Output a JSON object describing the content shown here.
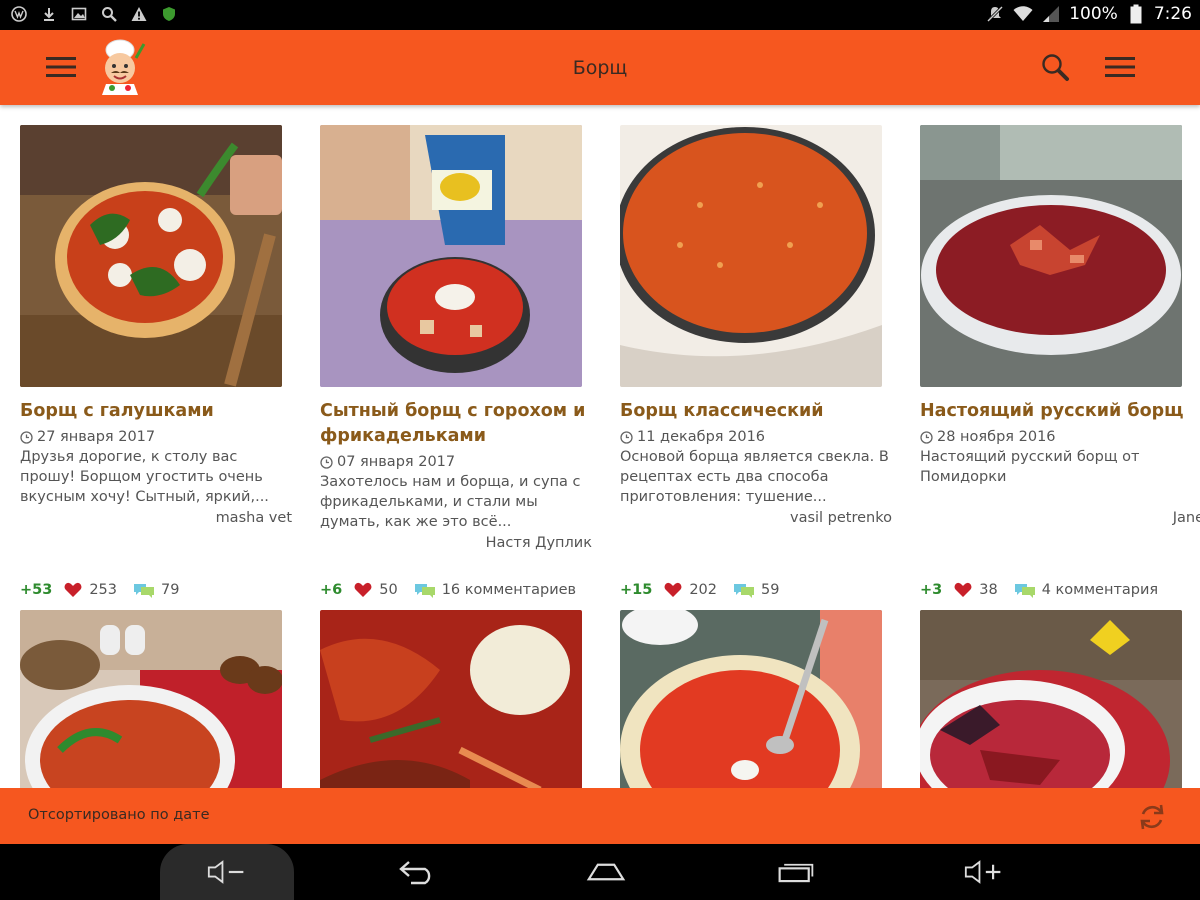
{
  "status_bar": {
    "battery": "100%",
    "time": "7:26",
    "left_icons": [
      "vpn-icon",
      "download-icon",
      "image-icon",
      "search-icon",
      "warning-icon",
      "shield-icon"
    ],
    "right_icons": [
      "silent-icon",
      "wifi-icon",
      "signal-icon",
      "battery-icon"
    ]
  },
  "app_bar": {
    "title": "Борщ",
    "icons": [
      "menu-icon",
      "chef-logo",
      "search-icon",
      "overflow-menu-icon"
    ]
  },
  "accent_color": "#f6571f",
  "recipes": [
    {
      "title": "Борщ с галушками",
      "date": "27 января 2017",
      "description": "Друзья дорогие, к столу вас прошу! Борщом угостить очень вкусным хочу! Сытный, яркий,...",
      "author": "masha vet",
      "rating": "+53",
      "likes": "253",
      "comments": "79"
    },
    {
      "title": "Сытный борщ с горохом и фрикадельками",
      "date": "07 января 2017",
      "description": "Захотелось нам и борща, и супа с фрикадельками, и стали мы думать, как же это всё...",
      "author": "Настя Дуплик",
      "rating": "+6",
      "likes": "50",
      "comments": "16 комментариев"
    },
    {
      "title": "Борщ классический",
      "date": "11 декабря 2016",
      "description": "Основой борща является свекла. В рецептах есть два способа приготовления: тушение...",
      "author": "vasil petrenko",
      "rating": "+15",
      "likes": "202",
      "comments": "59"
    },
    {
      "title": "Настоящий русский борщ",
      "date": "28 ноября 2016",
      "description": "Настоящий русский борщ от Помидорки",
      "author": "Jane",
      "rating": "+3",
      "likes": "38",
      "comments": "4 комментария"
    }
  ],
  "second_row_thumbnails": [
    "borscht-photo-5",
    "borscht-photo-6",
    "borscht-photo-7",
    "borscht-photo-8"
  ],
  "sort_bar": {
    "label": "Отсортировано по дате",
    "icon": "refresh-icon"
  },
  "nav_bar": {
    "icons": [
      "volume-down-icon",
      "back-icon",
      "home-icon",
      "recents-icon",
      "volume-up-icon"
    ]
  }
}
